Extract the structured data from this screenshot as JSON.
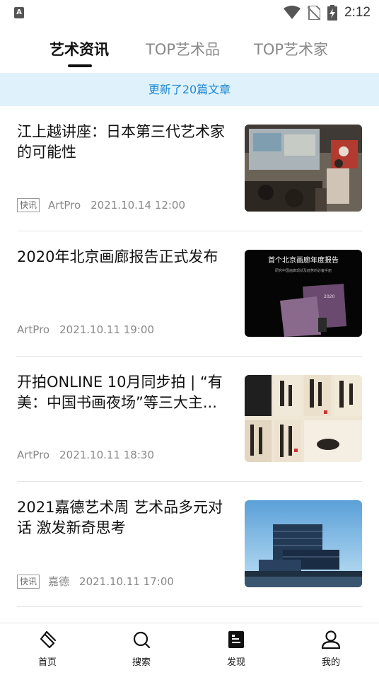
{
  "status_bar": {
    "left_badge": "A",
    "time": "2:12"
  },
  "tabs": [
    {
      "label": "艺术资讯",
      "active": true
    },
    {
      "label": "TOP艺术品",
      "active": false
    },
    {
      "label": "TOP艺术家",
      "active": false
    }
  ],
  "notice": "更新了20篇文章",
  "articles": [
    {
      "title": "江上越讲座：日本第三代艺术家的可能性",
      "tag": "快讯",
      "source": "ArtPro",
      "date": "2021.10.14 12:00"
    },
    {
      "title": "2020年北京画廊报告正式发布",
      "source": "ArtPro",
      "date": "2021.10.11 19:00"
    },
    {
      "title": "开拍ONLINE 10月同步拍 | “有美：中国书画夜场”等三大主...",
      "source": "ArtPro",
      "date": "2021.10.11 18:30"
    },
    {
      "title": "2021嘉德艺术周 艺术品多元对话 激发新奇思考",
      "tag": "快讯",
      "source": "嘉德",
      "date": "2021.10.11 17:00"
    }
  ],
  "thumb_text": {
    "report_title": "首个北京画廊年度报告",
    "report_subtitle": "研究中国画廊现状及趋势的必备手册",
    "book_year": "2020"
  },
  "bottom_nav": [
    {
      "label": "首页",
      "icon": "diamond-icon"
    },
    {
      "label": "搜索",
      "icon": "search-icon"
    },
    {
      "label": "发现",
      "icon": "discover-icon"
    },
    {
      "label": "我的",
      "icon": "user-icon"
    }
  ],
  "colors": {
    "accent": "#1d86d2",
    "notice_bg": "#dff2fb"
  }
}
